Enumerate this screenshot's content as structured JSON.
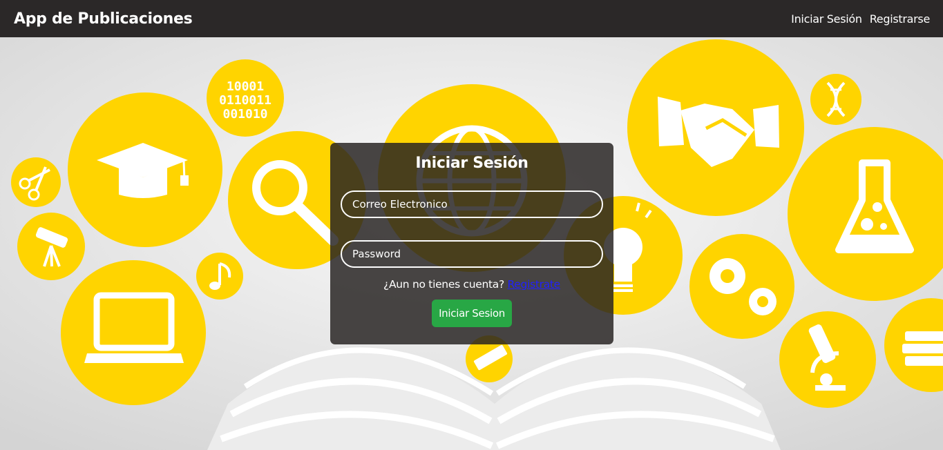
{
  "navbar": {
    "brand": "App de Publicaciones",
    "links": {
      "login": "Iniciar Sesión",
      "register": "Registrarse"
    }
  },
  "theme": {
    "accent_yellow": "#ffd400",
    "nav_bg": "#2b2828",
    "button_green": "#28a745",
    "link_blue": "#2020ff"
  },
  "background": {
    "icons": [
      "graduation-cap-icon",
      "binary-code-icon",
      "magnifier-icon",
      "globe-icon",
      "handshake-icon",
      "dna-icon",
      "flask-icon",
      "scissors-icon",
      "telescope-icon",
      "music-note-icon",
      "laptop-icon",
      "lightbulb-icon",
      "gears-icon",
      "microscope-icon",
      "books-icon",
      "ruler-icon",
      "open-book-icon"
    ],
    "binary_text": [
      "10001",
      "0110011",
      "001010"
    ]
  },
  "login": {
    "title": "Iniciar Sesión",
    "email_placeholder": "Correo Electronico",
    "password_placeholder": "Password",
    "no_account_text": "¿Aun no tienes cuenta?",
    "register_link": "Registrate",
    "submit_label": "Iniciar Sesion"
  }
}
